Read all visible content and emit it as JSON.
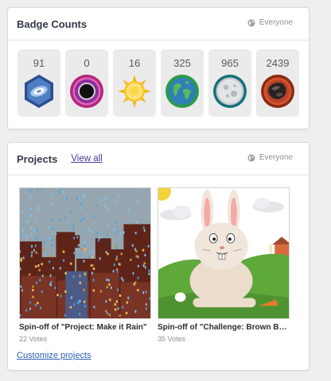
{
  "badges_card": {
    "title": "Badge Counts",
    "visibility": "Everyone",
    "badges": [
      {
        "count": "91",
        "icon": "blue-hexagon-badge-icon"
      },
      {
        "count": "0",
        "icon": "black-hole-badge-icon"
      },
      {
        "count": "16",
        "icon": "sun-badge-icon"
      },
      {
        "count": "325",
        "icon": "earth-badge-icon"
      },
      {
        "count": "965",
        "icon": "moon-badge-icon"
      },
      {
        "count": "2439",
        "icon": "meteorite-badge-icon"
      }
    ]
  },
  "projects_card": {
    "title": "Projects",
    "view_all": "View all",
    "visibility": "Everyone",
    "projects": [
      {
        "title": "Spin-off of \"Project: Make it Rain\"",
        "votes": "22 Votes"
      },
      {
        "title": "Spin-off of \"Challenge: Brown Bucky\"",
        "votes": "35 Votes"
      }
    ],
    "customize": "Customize projects"
  },
  "colors": {
    "link_purple": "#4a3a9a",
    "link_blue": "#2a5fb0",
    "tile_bg": "#ebebeb"
  }
}
